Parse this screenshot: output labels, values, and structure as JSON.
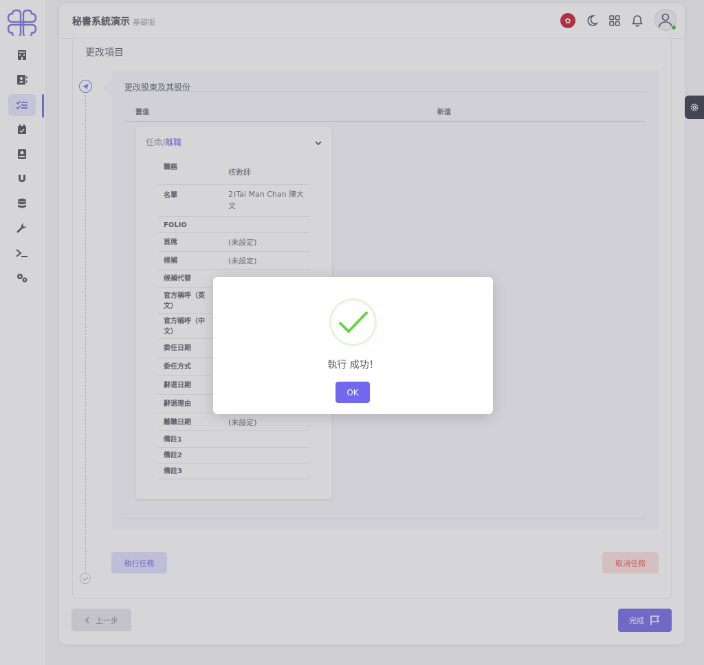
{
  "header": {
    "title": "秘書系統演示",
    "edition": "基礎版"
  },
  "sidebar": {
    "items": [
      {
        "icon": "building-icon"
      },
      {
        "icon": "contacts-icon"
      },
      {
        "icon": "checklist-icon",
        "active": true
      },
      {
        "icon": "calendar-check-icon"
      },
      {
        "icon": "book-icon"
      },
      {
        "icon": "magnet-icon"
      },
      {
        "icon": "database-icon"
      },
      {
        "icon": "wrench-icon"
      },
      {
        "icon": "terminal-icon"
      },
      {
        "icon": "cogs-icon"
      }
    ]
  },
  "page": {
    "section_title": "更改項目",
    "change_title": "更改股東及其股份",
    "columns": {
      "old": "舊值",
      "new": "新值"
    },
    "detail": {
      "head_prefix": "任命/",
      "head_accent": "離職",
      "rows": [
        {
          "label": "職務",
          "value": "核數師"
        },
        {
          "label": "名單",
          "value": "2)Tai Man Chan 陳大文"
        },
        {
          "label": "FOLIO",
          "value": ""
        },
        {
          "label": "首席",
          "value": "(未設定)"
        },
        {
          "label": "候補",
          "value": "(未設定)"
        },
        {
          "label": "候補代替",
          "value": ""
        },
        {
          "label": "官方稱呼（英文）",
          "value": ""
        },
        {
          "label": "官方稱呼（中文）",
          "value": ""
        },
        {
          "label": "委任日期",
          "value": ""
        },
        {
          "label": "委任方式",
          "value": ""
        },
        {
          "label": "辭退日期",
          "value": ""
        },
        {
          "label": "辭退理由",
          "value": ""
        },
        {
          "label": "離職日期",
          "value": "(未設定)"
        },
        {
          "label": "備註1",
          "value": ""
        },
        {
          "label": "備註2",
          "value": ""
        },
        {
          "label": "備註3",
          "value": ""
        }
      ]
    },
    "buttons": {
      "execute": "執行任務",
      "cancel": "取消任務",
      "prev": "上一步",
      "done": "完成"
    }
  },
  "modal": {
    "message": "執行 成功！",
    "ok": "OK"
  },
  "colors": {
    "primary": "#7267ef",
    "danger": "#ea5455",
    "success": "#6fcf4a"
  }
}
